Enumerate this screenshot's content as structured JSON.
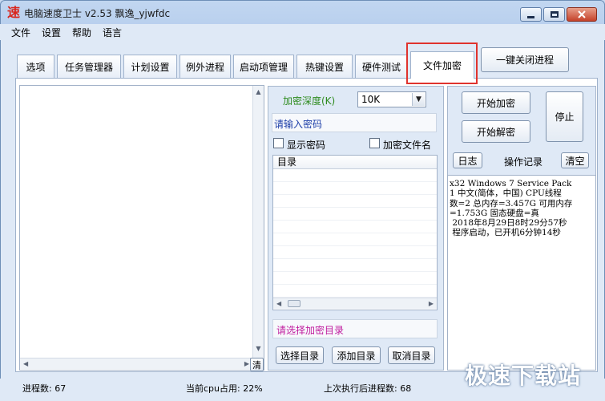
{
  "window": {
    "app_icon_char": "速",
    "title": "电脑速度卫士 v2.53  飘逸_yjwfdc"
  },
  "menu": [
    "文件",
    "设置",
    "帮助",
    "语言"
  ],
  "tabs": [
    "选项",
    "任务管理器",
    "计划设置",
    "例外进程",
    "启动项管理",
    "热键设置",
    "硬件测试",
    "文件加密"
  ],
  "active_tab": "文件加密",
  "close_all_button": "一键关闭进程",
  "encryption": {
    "depth_label": "加密深度(K)",
    "depth_value": "10K",
    "password_placeholder": "请输入密码",
    "show_password_label": "显示密码",
    "encrypt_filename_label": "加密文件名",
    "dir_header": "目录",
    "select_dir_hint": "请选择加密目录",
    "select_dir_button": "选择目录",
    "add_dir_button": "添加目录",
    "cancel_dir_button": "取消目录",
    "clear_short_button": "清"
  },
  "actions": {
    "start_encrypt": "开始加密",
    "start_decrypt": "开始解密",
    "stop": "停止",
    "log_button": "日志",
    "log_title": "操作记录",
    "clear_button": "清空"
  },
  "log_text": "x32 Windows 7 Service Pack\n1 中文(简体，中国) CPU线程\n数=2 总内存=3.457G 可用内存\n=1.753G 固态硬盘=真\n 2018年8月29日8时29分57秒\n 程序启动，已开机6分钟14秒",
  "status": {
    "process_count": "进程数: 67",
    "cpu_usage": "当前cpu占用: 22%",
    "last_process_count": "上次执行后进程数: 68"
  },
  "watermark": "极速下载站",
  "colors": {
    "accent_red": "#e0332d",
    "label_green": "#2e8b1e",
    "password_blue": "#1c3ea8",
    "hint_magenta": "#c01c9e"
  }
}
